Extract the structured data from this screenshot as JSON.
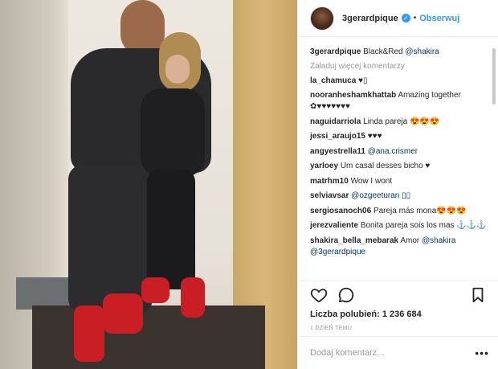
{
  "header": {
    "username": "3gerardpique",
    "dot": "•",
    "follow_label": "Obserwuj",
    "verified_glyph": "✓"
  },
  "caption": {
    "user": "3gerardpique",
    "text": "Black&Red",
    "mention": "@shakira"
  },
  "load_more": "Załaduj więcej komentarzy",
  "comments": [
    {
      "user": "la_chamuca",
      "text": "♥▯",
      "mention": ""
    },
    {
      "user": "nooranheshamkhattab",
      "text": "Amazing together ✿♥♥♥♥♥♥♥",
      "mention": ""
    },
    {
      "user": "naguidarriola",
      "text": "Linda pareja 😍😍😍",
      "mention": ""
    },
    {
      "user": "jessi_araujo15",
      "text": "♥♥♥",
      "mention": ""
    },
    {
      "user": "angyestrella11",
      "text": "",
      "mention": "@ana.crismer"
    },
    {
      "user": "yarloey",
      "text": "Um casal desses bicho ♥",
      "mention": ""
    },
    {
      "user": "matrhm10",
      "text": "Wow I wont",
      "mention": ""
    },
    {
      "user": "selviavsar",
      "text": "",
      "mention": "@ozgeeturan ▯▯"
    },
    {
      "user": "sergiosanoch06",
      "text": "Pareja más mona😍😍😍",
      "mention": ""
    },
    {
      "user": "jerezvaliente",
      "text": "Bonita pareja sois los mas ⚓⚓⚓",
      "mention": ""
    },
    {
      "user": "shakira_bella_mebarak",
      "text": "Amor",
      "mention": "@shakira @3gerardpique"
    }
  ],
  "likes_label": "Liczba polubień: 1 236 684",
  "timestamp": "1 DZIEŃ TEMU",
  "add_comment_placeholder": "Dodaj komentarz...",
  "more_glyph": "•••",
  "colors": {
    "link": "#3897f0",
    "text": "#262626",
    "muted": "#999999",
    "border": "#efefef"
  },
  "icons": [
    "heart-icon",
    "comment-icon",
    "bookmark-icon",
    "verified-icon",
    "more-options-icon"
  ]
}
